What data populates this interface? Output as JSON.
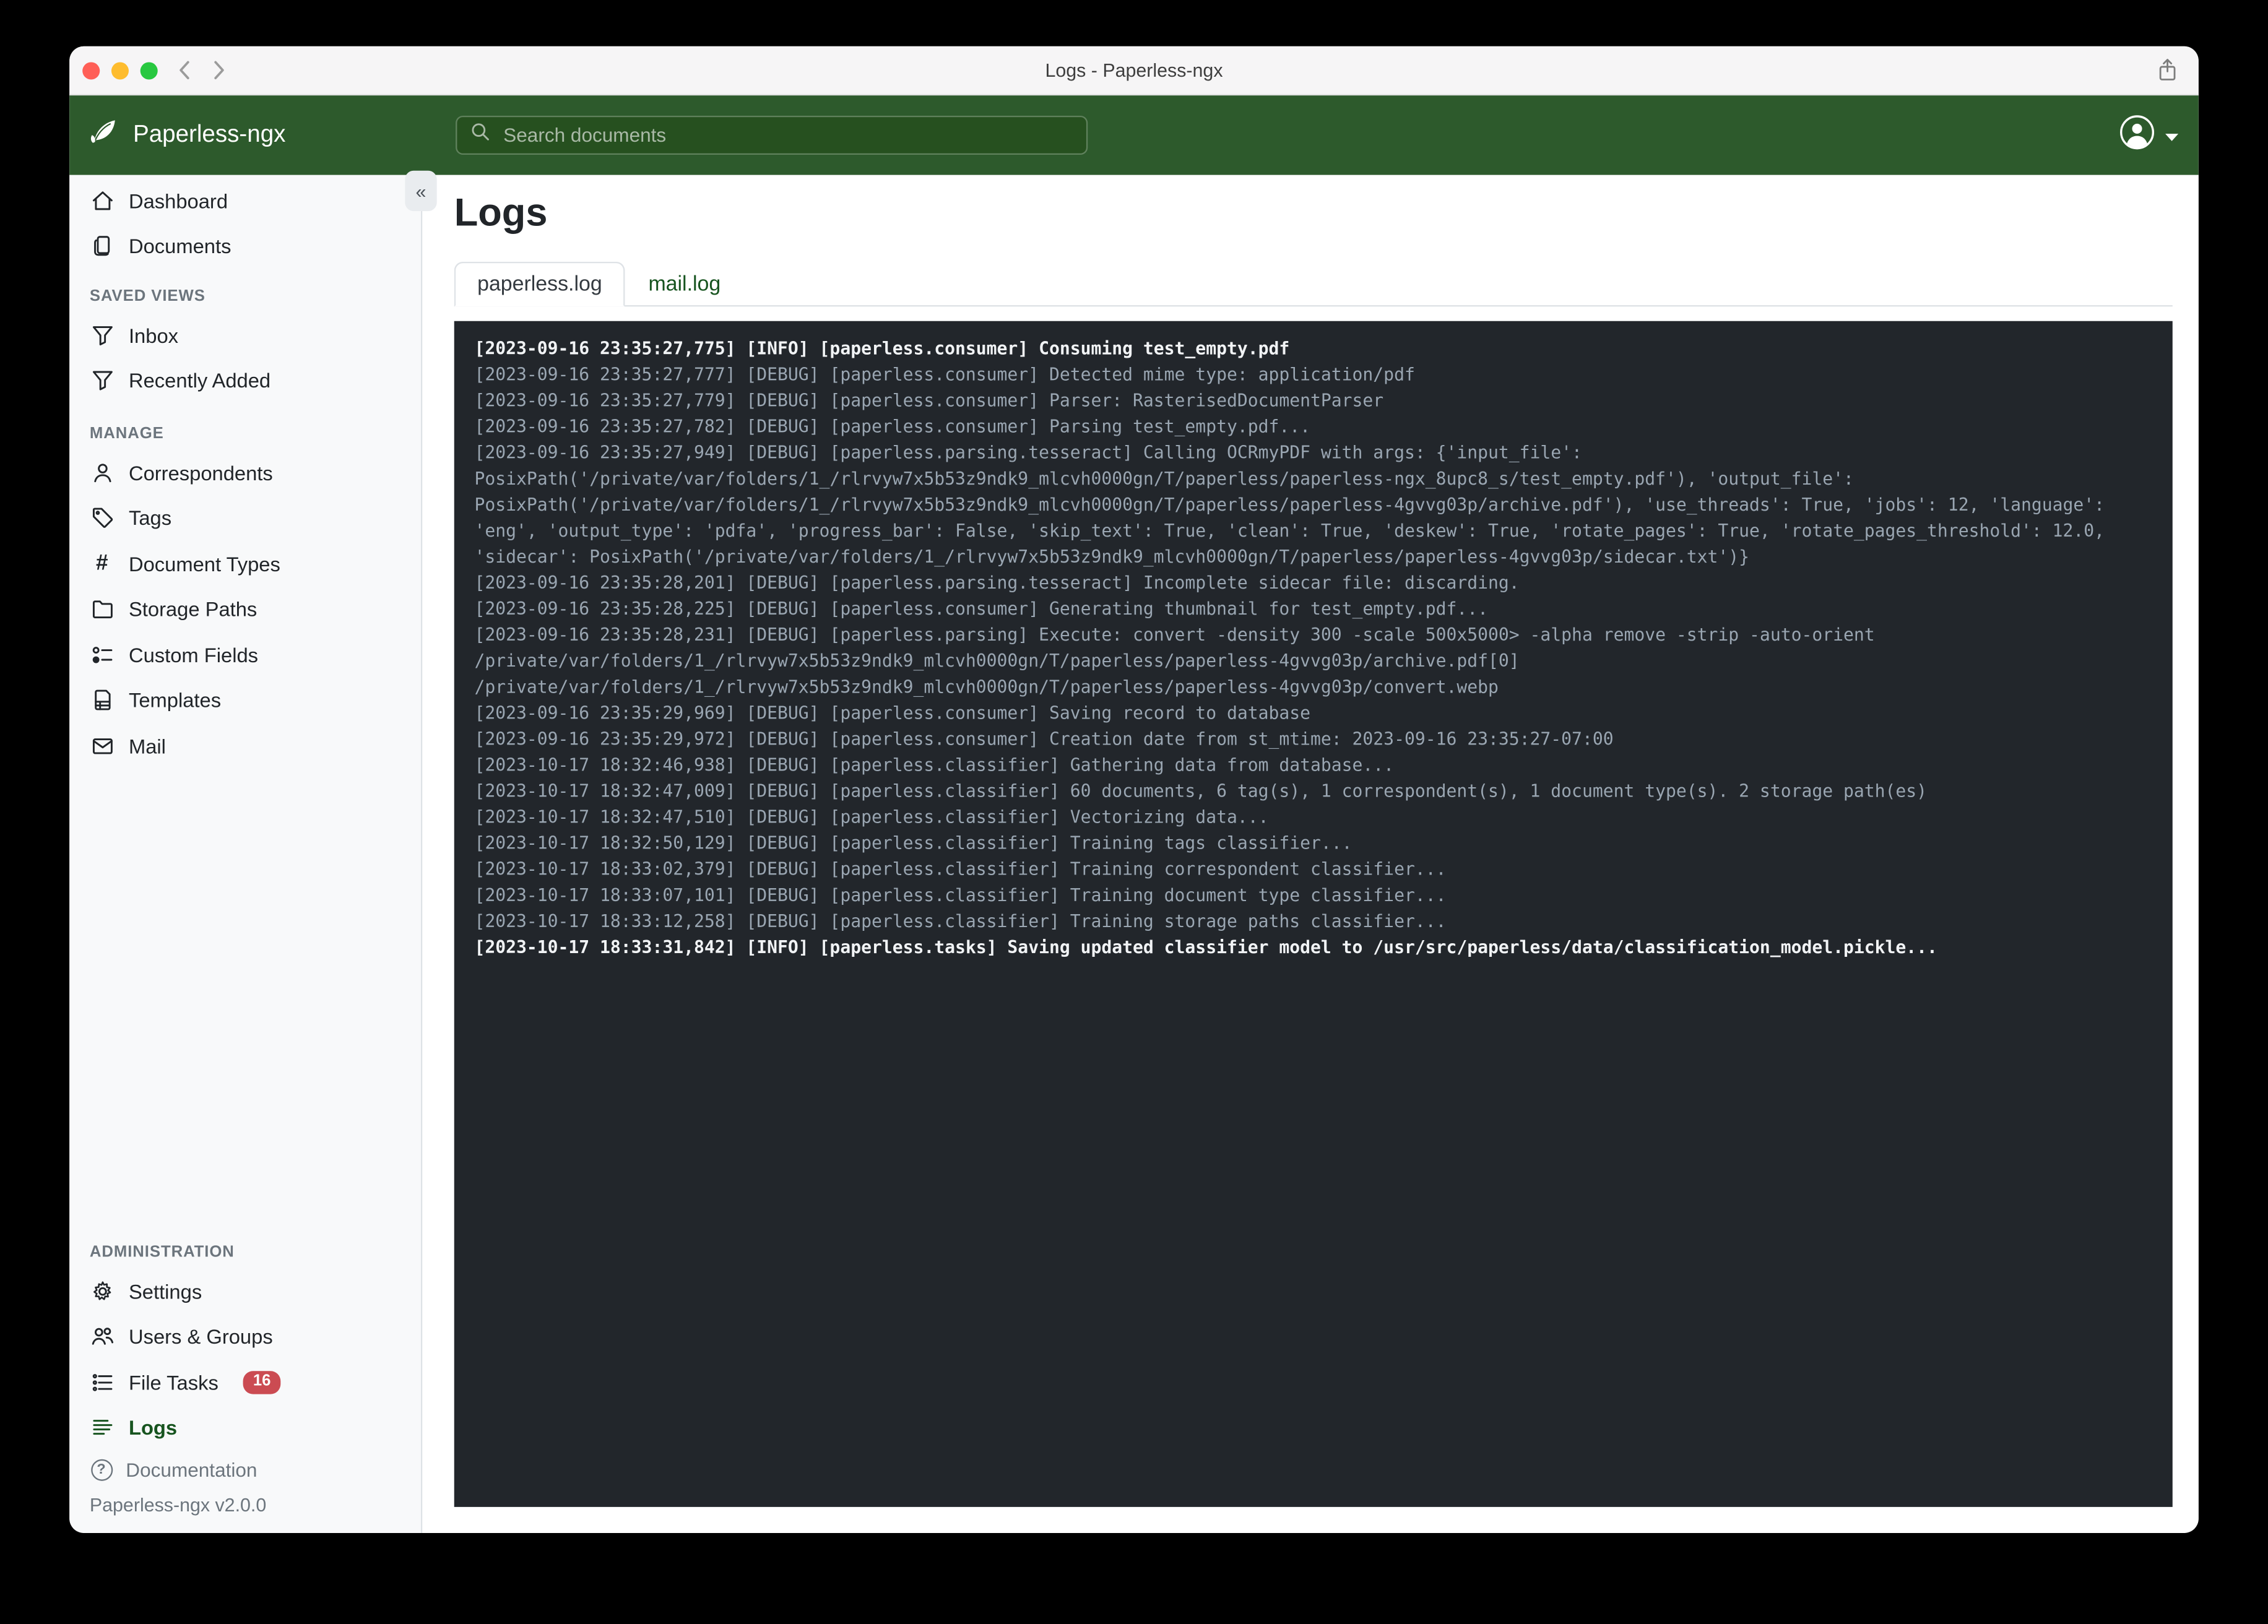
{
  "colors": {
    "navbar_green": "#2d5a2c",
    "brand_green": "#17541f",
    "badge_red": "#cb4b52",
    "log_background": "#22262b",
    "log_debug_text": "#9aa6b2",
    "log_info_text": "#f1f3f5",
    "sidebar_background": "#f8f9fa",
    "traffic_red": "#ff5f57",
    "traffic_yellow": "#febc2e",
    "traffic_green": "#28c840"
  },
  "window": {
    "title": "Logs - Paperless-ngx"
  },
  "header": {
    "brand": "Paperless-ngx",
    "search_placeholder": "Search documents",
    "icons": [
      "leaf-logo-icon",
      "search-icon",
      "person-circle-icon",
      "caret-down-icon"
    ]
  },
  "sidebar": {
    "collapse_glyph": "«",
    "primary": [
      {
        "label": "Dashboard",
        "icon": "home"
      },
      {
        "label": "Documents",
        "icon": "documents"
      }
    ],
    "sections": [
      {
        "heading": "SAVED VIEWS",
        "items": [
          {
            "label": "Inbox",
            "icon": "funnel"
          },
          {
            "label": "Recently Added",
            "icon": "funnel"
          }
        ]
      },
      {
        "heading": "MANAGE",
        "items": [
          {
            "label": "Correspondents",
            "icon": "person"
          },
          {
            "label": "Tags",
            "icon": "tag"
          },
          {
            "label": "Document Types",
            "icon": "hash"
          },
          {
            "label": "Storage Paths",
            "icon": "folder"
          },
          {
            "label": "Custom Fields",
            "icon": "ui-radios"
          },
          {
            "label": "Templates",
            "icon": "file-ruled"
          },
          {
            "label": "Mail",
            "icon": "envelope"
          }
        ]
      },
      {
        "heading": "ADMINISTRATION",
        "push_to_bottom": true,
        "items": [
          {
            "label": "Settings",
            "icon": "gear"
          },
          {
            "label": "Users & Groups",
            "icon": "people"
          },
          {
            "label": "File Tasks",
            "icon": "list-task",
            "badge": "16"
          },
          {
            "label": "Logs",
            "icon": "body-text",
            "active": true
          }
        ]
      }
    ],
    "footer": {
      "documentation_label": "Documentation",
      "version": "Paperless-ngx v2.0.0"
    }
  },
  "main": {
    "title": "Logs",
    "tabs": [
      {
        "label": "paperless.log",
        "active": true
      },
      {
        "label": "mail.log",
        "active": false
      }
    ]
  },
  "logs": {
    "lines": [
      {
        "level": "info",
        "text": "[2023-09-16 23:35:27,775] [INFO] [paperless.consumer] Consuming test_empty.pdf"
      },
      {
        "level": "debug",
        "text": "[2023-09-16 23:35:27,777] [DEBUG] [paperless.consumer] Detected mime type: application/pdf"
      },
      {
        "level": "debug",
        "text": "[2023-09-16 23:35:27,779] [DEBUG] [paperless.consumer] Parser: RasterisedDocumentParser"
      },
      {
        "level": "debug",
        "text": "[2023-09-16 23:35:27,782] [DEBUG] [paperless.consumer] Parsing test_empty.pdf..."
      },
      {
        "level": "debug",
        "text": "[2023-09-16 23:35:27,949] [DEBUG] [paperless.parsing.tesseract] Calling OCRmyPDF with args: {'input_file': PosixPath('/private/var/folders/1_/rlrvyw7x5b53z9ndk9_mlcvh0000gn/T/paperless/paperless-ngx_8upc8_s/test_empty.pdf'), 'output_file': PosixPath('/private/var/folders/1_/rlrvyw7x5b53z9ndk9_mlcvh0000gn/T/paperless/paperless-4gvvg03p/archive.pdf'), 'use_threads': True, 'jobs': 12, 'language': 'eng', 'output_type': 'pdfa', 'progress_bar': False, 'skip_text': True, 'clean': True, 'deskew': True, 'rotate_pages': True, 'rotate_pages_threshold': 12.0, 'sidecar': PosixPath('/private/var/folders/1_/rlrvyw7x5b53z9ndk9_mlcvh0000gn/T/paperless/paperless-4gvvg03p/sidecar.txt')}"
      },
      {
        "level": "debug",
        "text": "[2023-09-16 23:35:28,201] [DEBUG] [paperless.parsing.tesseract] Incomplete sidecar file: discarding."
      },
      {
        "level": "debug",
        "text": "[2023-09-16 23:35:28,225] [DEBUG] [paperless.consumer] Generating thumbnail for test_empty.pdf..."
      },
      {
        "level": "debug",
        "text": "[2023-09-16 23:35:28,231] [DEBUG] [paperless.parsing] Execute: convert -density 300 -scale 500x5000> -alpha remove -strip -auto-orient /private/var/folders/1_/rlrvyw7x5b53z9ndk9_mlcvh0000gn/T/paperless/paperless-4gvvg03p/archive.pdf[0] /private/var/folders/1_/rlrvyw7x5b53z9ndk9_mlcvh0000gn/T/paperless/paperless-4gvvg03p/convert.webp"
      },
      {
        "level": "debug",
        "text": "[2023-09-16 23:35:29,969] [DEBUG] [paperless.consumer] Saving record to database"
      },
      {
        "level": "debug",
        "text": "[2023-09-16 23:35:29,972] [DEBUG] [paperless.consumer] Creation date from st_mtime: 2023-09-16 23:35:27-07:00"
      },
      {
        "level": "debug",
        "text": "[2023-10-17 18:32:46,938] [DEBUG] [paperless.classifier] Gathering data from database..."
      },
      {
        "level": "debug",
        "text": "[2023-10-17 18:32:47,009] [DEBUG] [paperless.classifier] 60 documents, 6 tag(s), 1 correspondent(s), 1 document type(s). 2 storage path(es)"
      },
      {
        "level": "debug",
        "text": "[2023-10-17 18:32:47,510] [DEBUG] [paperless.classifier] Vectorizing data..."
      },
      {
        "level": "debug",
        "text": "[2023-10-17 18:32:50,129] [DEBUG] [paperless.classifier] Training tags classifier..."
      },
      {
        "level": "debug",
        "text": "[2023-10-17 18:33:02,379] [DEBUG] [paperless.classifier] Training correspondent classifier..."
      },
      {
        "level": "debug",
        "text": "[2023-10-17 18:33:07,101] [DEBUG] [paperless.classifier] Training document type classifier..."
      },
      {
        "level": "debug",
        "text": "[2023-10-17 18:33:12,258] [DEBUG] [paperless.classifier] Training storage paths classifier..."
      },
      {
        "level": "info",
        "text": "[2023-10-17 18:33:31,842] [INFO] [paperless.tasks] Saving updated classifier model to /usr/src/paperless/data/classification_model.pickle..."
      }
    ]
  }
}
